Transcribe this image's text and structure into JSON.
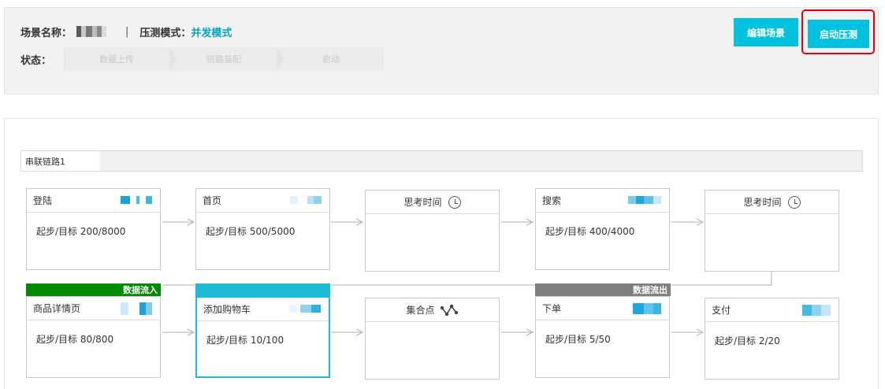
{
  "header": {
    "scene_name_label": "场景名称：",
    "separator": "|",
    "mode_label": "压测模式：",
    "mode_value": "并发模式",
    "status_label": "状态：",
    "steps": [
      "数据上传",
      "链路装配",
      "启动"
    ],
    "edit_button": "编辑场景",
    "start_button": "启动压测"
  },
  "chain": {
    "tab_label": "串联链路1"
  },
  "tags": {
    "data_in": "数据流入",
    "data_out": "数据流出"
  },
  "nodes": [
    {
      "title": "登陆",
      "value": "起步/目标 200/8000"
    },
    {
      "title": "首页",
      "value": "起步/目标 500/5000"
    },
    {
      "title": "思考时间",
      "value": ""
    },
    {
      "title": "搜索",
      "value": "起步/目标 400/4000"
    },
    {
      "title": "思考时间",
      "value": ""
    },
    {
      "title": "商品详情页",
      "value": "起步/目标 80/800"
    },
    {
      "title": "添加购物车",
      "value": "起步/目标 10/100"
    },
    {
      "title": "集合点",
      "value": ""
    },
    {
      "title": "下单",
      "value": "起步/目标 5/50"
    },
    {
      "title": "支付",
      "value": "起步/目标 2/20"
    }
  ],
  "icons": {
    "think_time": "clock-icon",
    "rendezvous": "rendezvous-icon"
  },
  "colors": {
    "accent": "#00c1de",
    "mode_text": "#00a7c4",
    "highlight_border": "#e60012",
    "data_in_tag": "#008a00",
    "data_out_tag": "#7f7f7f",
    "selected_border": "#1ebbd7"
  }
}
